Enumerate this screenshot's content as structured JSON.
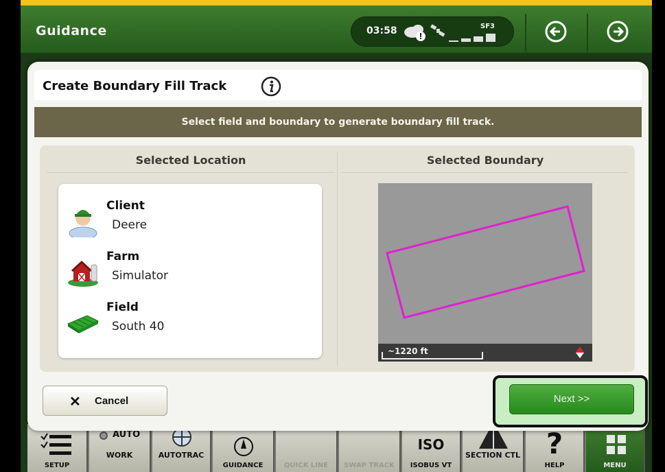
{
  "header": {
    "title": "Guidance",
    "clock": "03:58",
    "signal_label": "SF3"
  },
  "dialog": {
    "title": "Create Boundary Fill Track",
    "subtitle": "Select field and boundary to generate boundary fill track.",
    "left_heading": "Selected Location",
    "right_heading": "Selected Boundary",
    "location": [
      {
        "label": "Client",
        "value": "Deere",
        "icon": "client-person-icon"
      },
      {
        "label": "Farm",
        "value": "Simulator",
        "icon": "farm-barn-icon"
      },
      {
        "label": "Field",
        "value": "South 40",
        "icon": "field-icon"
      }
    ],
    "scale_label": "~1220 ft",
    "cancel_label": "Cancel",
    "next_label": "Next >>"
  },
  "toolbar": {
    "setup": "SETUP",
    "work_auto": "AUTO",
    "work": "WORK",
    "autotrac": "AUTOTRAC",
    "guidance": "GUIDANCE",
    "quick_line": "QUICK LINE",
    "swap_track": "SWAP TRACK",
    "iso_logo": "ISO",
    "isobus": "ISOBUS VT",
    "section_ctl": "SECTION CTL",
    "help": "HELP",
    "menu": "MENU"
  },
  "colors": {
    "deere_green": "#367c2b",
    "boundary_line": "#e020d0",
    "band": "#6b6549"
  }
}
